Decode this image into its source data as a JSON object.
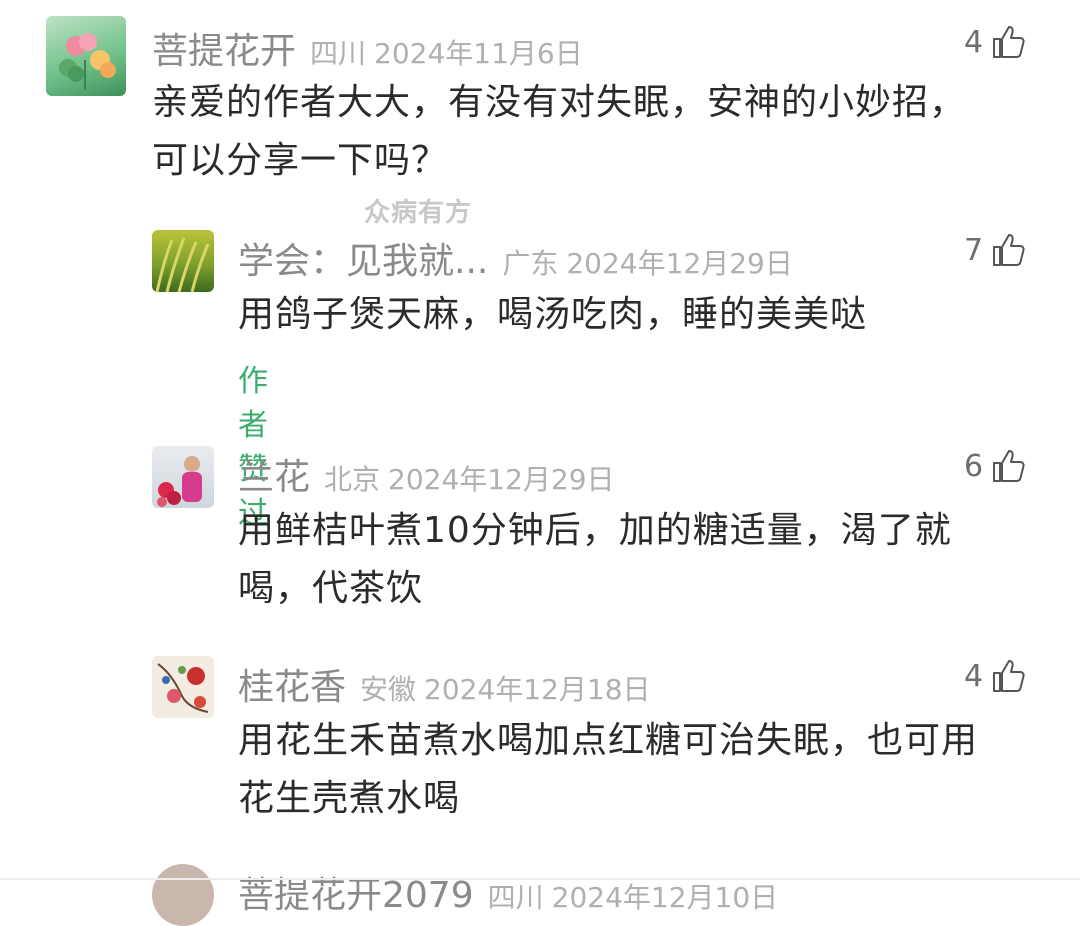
{
  "watermark": "众病有方",
  "top_comment": {
    "username": "菩提花开",
    "region": "四川",
    "date": "2024年11月6日",
    "like_count": "4",
    "text_line1": "亲爱的作者大大，有没有对失眠，安神的小妙招，",
    "text_line2": "可以分享一下吗？"
  },
  "replies": [
    {
      "username": "学会：见我就...",
      "region": "广东",
      "date": "2024年12月29日",
      "like_count": "7",
      "text_line1": "用鸽子煲天麻，喝汤吃肉，睡的美美哒",
      "author_liked": "作者赞过"
    },
    {
      "username": "兰花",
      "region": "北京",
      "date": "2024年12月29日",
      "like_count": "6",
      "text_line1": "用鲜桔叶煮10分钟后，加的糖适量，渴了就",
      "text_line2": "喝，代茶饮"
    },
    {
      "username": "桂花香",
      "region": "安徽",
      "date": "2024年12月18日",
      "like_count": "4",
      "text_line1": "用花生禾苗煮水喝加点红糖可治失眠，也可用",
      "text_line2": "花生壳煮水喝"
    }
  ],
  "partial_next": {
    "username": "菩提花开2079",
    "region": "四川",
    "date": "2024年12月10日"
  }
}
